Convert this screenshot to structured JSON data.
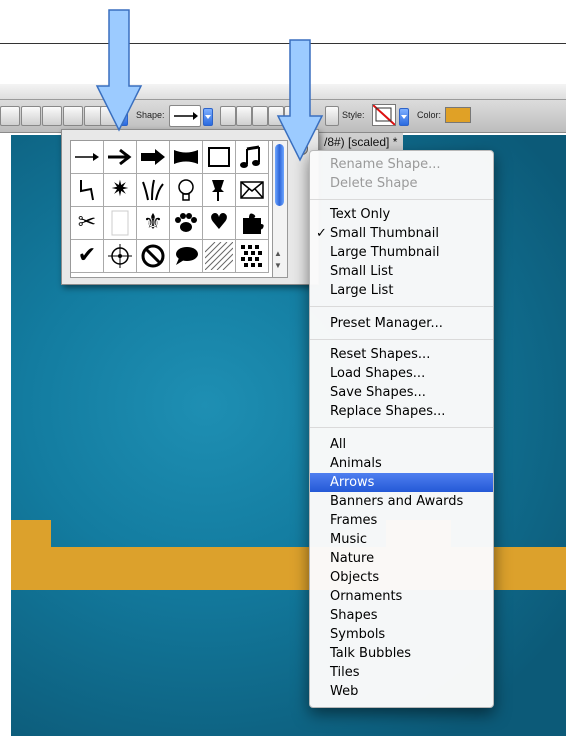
{
  "document": {
    "title": "/8#) [scaled] *"
  },
  "toolbar": {
    "shape_label": "Shape:",
    "style_label": "Style:",
    "color_label": "Color:",
    "color_value": "#e0a126"
  },
  "shape_panel": {
    "shapes": [
      "arrow-thin",
      "arrow-medium",
      "arrow-bold",
      "banner",
      "frame-rough",
      "music-note",
      "lightning",
      "starburst",
      "grass",
      "lightbulb",
      "pushpin",
      "envelope",
      "scissors",
      "blank-page",
      "fleur-de-lis",
      "dog-paw",
      "heart",
      "puzzle-piece",
      "checkmark",
      "crosshair",
      "no-symbol",
      "speech-bubble",
      "diagonal-tile",
      "dot-tile"
    ]
  },
  "menu": {
    "group_1": [
      {
        "label": "Rename Shape...",
        "enabled": false
      },
      {
        "label": "Delete Shape",
        "enabled": false
      }
    ],
    "group_2": [
      {
        "label": "Text Only",
        "checked": false
      },
      {
        "label": "Small Thumbnail",
        "checked": true
      },
      {
        "label": "Large Thumbnail",
        "checked": false
      },
      {
        "label": "Small List",
        "checked": false
      },
      {
        "label": "Large List",
        "checked": false
      }
    ],
    "group_3": [
      {
        "label": "Preset Manager..."
      }
    ],
    "group_4": [
      {
        "label": "Reset Shapes..."
      },
      {
        "label": "Load Shapes..."
      },
      {
        "label": "Save Shapes..."
      },
      {
        "label": "Replace Shapes..."
      }
    ],
    "group_5": [
      {
        "label": "All"
      },
      {
        "label": "Animals"
      },
      {
        "label": "Arrows",
        "highlighted": true
      },
      {
        "label": "Banners and Awards"
      },
      {
        "label": "Frames"
      },
      {
        "label": "Music"
      },
      {
        "label": "Nature"
      },
      {
        "label": "Objects"
      },
      {
        "label": "Ornaments"
      },
      {
        "label": "Shapes"
      },
      {
        "label": "Symbols"
      },
      {
        "label": "Talk Bubbles"
      },
      {
        "label": "Tiles"
      },
      {
        "label": "Web"
      }
    ],
    "check_glyph": "✓",
    "highlight_color": "#2f63dd"
  },
  "colors": {
    "canvas": "#137ca0",
    "stripe": "#dca12c",
    "annotation_arrow": "#9ccbff"
  }
}
